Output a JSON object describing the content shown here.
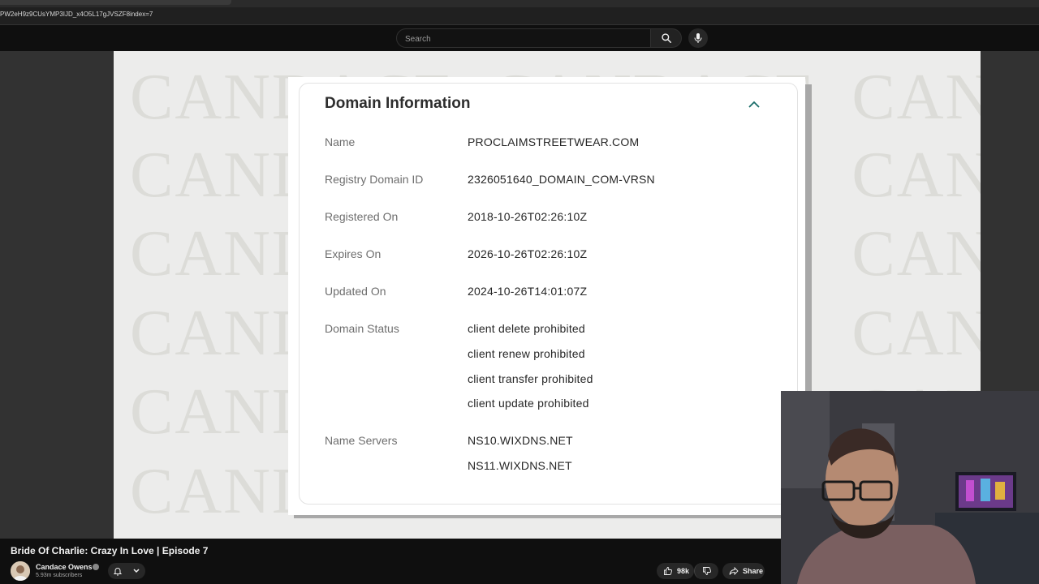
{
  "browser": {
    "url": "PW2eH9z9CUsYMP3IJD_x4O5L17gJVSZF8index=7"
  },
  "search": {
    "placeholder": "Search"
  },
  "watermark": {
    "text": "CANDACE"
  },
  "domain_card": {
    "title": "Domain Information",
    "rows": [
      {
        "label": "Name",
        "values": [
          "PROCLAIMSTREETWEAR.COM"
        ]
      },
      {
        "label": "Registry Domain ID",
        "values": [
          "2326051640_DOMAIN_COM-VRSN"
        ]
      },
      {
        "label": "Registered On",
        "values": [
          "2018-10-26T02:26:10Z"
        ]
      },
      {
        "label": "Expires On",
        "values": [
          "2026-10-26T02:26:10Z"
        ]
      },
      {
        "label": "Updated On",
        "values": [
          "2024-10-26T14:01:07Z"
        ]
      },
      {
        "label": "Domain Status",
        "values": [
          "client delete prohibited",
          "client renew prohibited",
          "client transfer prohibited",
          "client update prohibited"
        ]
      },
      {
        "label": "Name Servers",
        "values": [
          "NS10.WIXDNS.NET",
          "NS11.WIXDNS.NET"
        ]
      }
    ]
  },
  "video": {
    "title": "Bride Of Charlie: Crazy In Love | Episode 7",
    "channel": "Candace Owens",
    "subscribers": "5.93m subscribers",
    "likes": "98k",
    "share_label": "Share"
  },
  "icons": [
    "search-icon",
    "mic-icon",
    "chevron-up-icon",
    "bell-icon",
    "chevron-down-icon",
    "thumbs-up-icon",
    "thumbs-down-icon",
    "share-icon",
    "verified-icon"
  ]
}
